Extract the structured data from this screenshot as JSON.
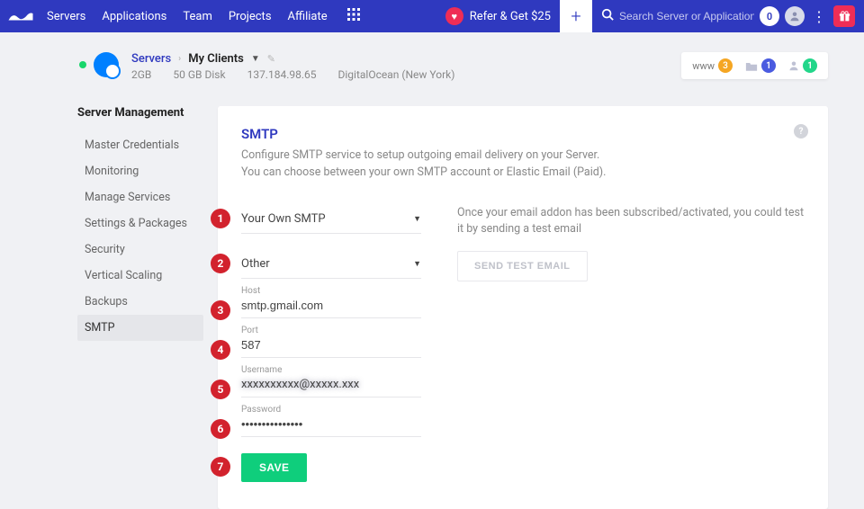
{
  "nav": {
    "links": [
      "Servers",
      "Applications",
      "Team",
      "Projects",
      "Affiliate"
    ],
    "refer": "Refer & Get $25",
    "search_placeholder": "Search Server or Application",
    "notif_count": "0"
  },
  "breadcrumb": {
    "servers": "Servers",
    "client": "My Clients",
    "specs": {
      "ram": "2GB",
      "disk": "50 GB Disk",
      "ip": "137.184.98.65",
      "provider": "DigitalOcean (New York)"
    }
  },
  "summary": {
    "www_label": "www",
    "www_count": "3",
    "projects_count": "1",
    "users_count": "1"
  },
  "sidebar": {
    "title": "Server Management",
    "items": [
      "Master Credentials",
      "Monitoring",
      "Manage Services",
      "Settings & Packages",
      "Security",
      "Vertical Scaling",
      "Backups",
      "SMTP"
    ],
    "active_index": 7
  },
  "panel": {
    "title": "SMTP",
    "desc": "Configure SMTP service to setup outgoing email delivery on your Server. You can choose between your own SMTP account or Elastic Email (Paid).",
    "side_text": "Once your email addon has been subscribed/activated, you could test it by sending a test email",
    "test_btn": "SEND TEST EMAIL",
    "save": "SAVE"
  },
  "form": {
    "smtp_type": "Your Own SMTP",
    "provider": "Other",
    "host_label": "Host",
    "host": "smtp.gmail.com",
    "port_label": "Port",
    "port": "587",
    "username_label": "Username",
    "username": "xxxxxxxxxx@xxxxx.xxx",
    "password_label": "Password",
    "password": "•••••••••••••••"
  },
  "annotations": [
    "1",
    "2",
    "3",
    "4",
    "5",
    "6",
    "7"
  ]
}
